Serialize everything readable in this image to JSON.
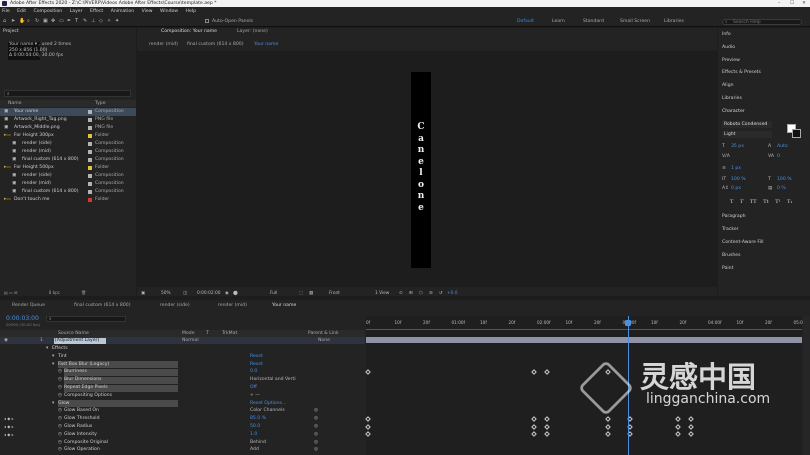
{
  "window": {
    "title": "Adobe After Effects 2020 - Z:\\C:\\PIVERP\\Videos Adobe After Effects\\Course\\template.aep *",
    "controls": [
      "–",
      "☐",
      "✕"
    ]
  },
  "menu": [
    "File",
    "Edit",
    "Composition",
    "Layer",
    "Effect",
    "Animation",
    "View",
    "Window",
    "Help"
  ],
  "toolbar": {
    "snapping_label": "Auto-Open Panels",
    "workspaces": [
      "Default",
      "Learn",
      "Standard",
      "Small Screen",
      "Libraries"
    ],
    "active_workspace": "Default",
    "search_placeholder": "Search Help"
  },
  "project": {
    "tab": "Project",
    "info_lines": [
      "Your name ▾ , used 2 times",
      "250 x 856 (1.00)",
      "Δ 0:00:04:00, 30.00 fps"
    ],
    "columns": [
      "Name",
      "Type"
    ],
    "items": [
      {
        "name": "Your name",
        "type": "Composition",
        "color": "#b3b3b3",
        "indent": 0,
        "selected": true
      },
      {
        "name": "Artwork_Right_Tag.png",
        "type": "PNG file",
        "color": "#b3b3b3",
        "indent": 0
      },
      {
        "name": "Artwork_Middle.png",
        "type": "PNG file",
        "color": "#b3b3b3",
        "indent": 0
      },
      {
        "name": "For Height 300px",
        "type": "Folder",
        "color": "#e0c43a",
        "indent": 0
      },
      {
        "name": "render (side)",
        "type": "Composition",
        "color": "#b3b3b3",
        "indent": 1
      },
      {
        "name": "render (mid)",
        "type": "Composition",
        "color": "#b3b3b3",
        "indent": 1
      },
      {
        "name": "final custom (614 x 800)",
        "type": "Composition",
        "color": "#b3b3b3",
        "indent": 1
      },
      {
        "name": "For Height 500px",
        "type": "Folder",
        "color": "#e0c43a",
        "indent": 0
      },
      {
        "name": "render (side)",
        "type": "Composition",
        "color": "#b3b3b3",
        "indent": 1
      },
      {
        "name": "render (mid)",
        "type": "Composition",
        "color": "#b3b3b3",
        "indent": 1
      },
      {
        "name": "final custom (614 x 800)",
        "type": "Composition",
        "color": "#b3b3b3",
        "indent": 1
      },
      {
        "name": "Don't touch me",
        "type": "Folder",
        "color": "#d23a3a",
        "indent": 0
      }
    ],
    "bpc": "8 bpc"
  },
  "composition": {
    "panel_tab": "Composition: Your name",
    "layer_tab": "Layer: (none)",
    "subtabs": [
      "render (mid)",
      "final custom (614 x 800)",
      "Your name"
    ],
    "active_subtab": "Your name",
    "vertical_text": "Canelone",
    "footer": {
      "zoom": "50%",
      "time": "0:00:02:00",
      "resolution": "Full",
      "view": "Front",
      "views": "1 View",
      "exposure": "+0.0"
    }
  },
  "right_panels": {
    "items": [
      "Info",
      "Audio",
      "Preview",
      "Effects & Presets",
      "Align",
      "Libraries"
    ],
    "character": {
      "title": "Character",
      "font": "Roboto Condensed",
      "style": "Light",
      "size": "35 px",
      "leading": "Auto",
      "tracking": "0",
      "vscale": "100 %",
      "hscale": "100 %",
      "baseline": "0 px",
      "tsume": "0 %",
      "stroke": "1 px",
      "style_buttons": [
        "T",
        "T",
        "TT",
        "Tt",
        "T¹",
        "T₁"
      ]
    },
    "lower_items": [
      "Paragraph",
      "Tracker",
      "Content-Aware Fill",
      "Brushes",
      "Paint"
    ]
  },
  "timeline": {
    "tabs": [
      "Render Queue",
      "final custom (614 x 800)",
      "render (side)",
      "render (mid)",
      "Your name"
    ],
    "active_tab": "Your name",
    "timecode": "0:00:03:00",
    "timecode_sub": "00090 (30.00 fps)",
    "columns": [
      "Source Name",
      "Mode",
      "T",
      "TrkMat",
      "Parent & Link"
    ],
    "layer": {
      "num": "1",
      "name": "[Adjustment Layer]",
      "mode": "Normal",
      "parent": "None"
    },
    "rows": [
      {
        "label": "Effects",
        "level": 1,
        "value": ""
      },
      {
        "label": "Tint",
        "level": 2,
        "value": "Reset",
        "value_color": "#4a8fe0"
      },
      {
        "label": "Fast Box Blur (Legacy)",
        "level": 2,
        "value": "Reset",
        "value_color": "#4a8fe0",
        "hl": true
      },
      {
        "label": "Blurriness",
        "level": 3,
        "value": "0.0",
        "value_color": "#4a8fe0",
        "hl": true
      },
      {
        "label": "Blur Dimensions",
        "level": 3,
        "value": "Horizontal and Verti",
        "value_color": "#bbb",
        "hl": true
      },
      {
        "label": "Repeat Edge Pixels",
        "level": 3,
        "value": "Off",
        "value_color": "#4a8fe0",
        "hl": true
      },
      {
        "label": "Compositing Options",
        "level": 3,
        "value": "+ —",
        "value_color": "#bbb"
      },
      {
        "label": "Glow",
        "level": 2,
        "value": "Reset   Options...",
        "value_color": "#4a8fe0",
        "hl": true
      },
      {
        "label": "Glow Based On",
        "level": 3,
        "value": "Color Channels",
        "value_color": "#bbb"
      },
      {
        "label": "Glow Threshold",
        "level": 3,
        "value": "85.0 %",
        "value_color": "#4a8fe0"
      },
      {
        "label": "Glow Radius",
        "level": 3,
        "value": "50.0",
        "value_color": "#4a8fe0"
      },
      {
        "label": "Glow Intensity",
        "level": 3,
        "value": "1.0",
        "value_color": "#4a8fe0"
      },
      {
        "label": "Composite Original",
        "level": 3,
        "value": "Behind",
        "value_color": "#bbb"
      },
      {
        "label": "Glow Operation",
        "level": 3,
        "value": "Add",
        "value_color": "#bbb"
      }
    ],
    "ruler": [
      "0f",
      "10f",
      "20f",
      "01:00f",
      "10f",
      "20f",
      "02:00f",
      "10f",
      "20f",
      "03:00f",
      "10f",
      "20f",
      "04:00f",
      "10f",
      "20f",
      "05:0"
    ],
    "keyframe_rows": [
      {
        "row": 3,
        "times": [
          0.0,
          1.9,
          2.05,
          2.75
        ]
      },
      {
        "row": 9,
        "times": [
          0.0,
          1.9,
          2.05,
          2.75,
          3.0,
          3.55,
          3.7
        ]
      },
      {
        "row": 10,
        "times": [
          0.0,
          1.9,
          2.05,
          2.75,
          3.0,
          3.55,
          3.7
        ]
      },
      {
        "row": 11,
        "times": [
          0.0,
          1.9,
          2.05,
          2.75,
          3.0,
          3.55,
          3.7
        ]
      }
    ],
    "duration_seconds": 5,
    "current_time_seconds": 3.0
  },
  "watermark": {
    "brand": "灵感中国",
    "url": "lingganchina.com"
  }
}
